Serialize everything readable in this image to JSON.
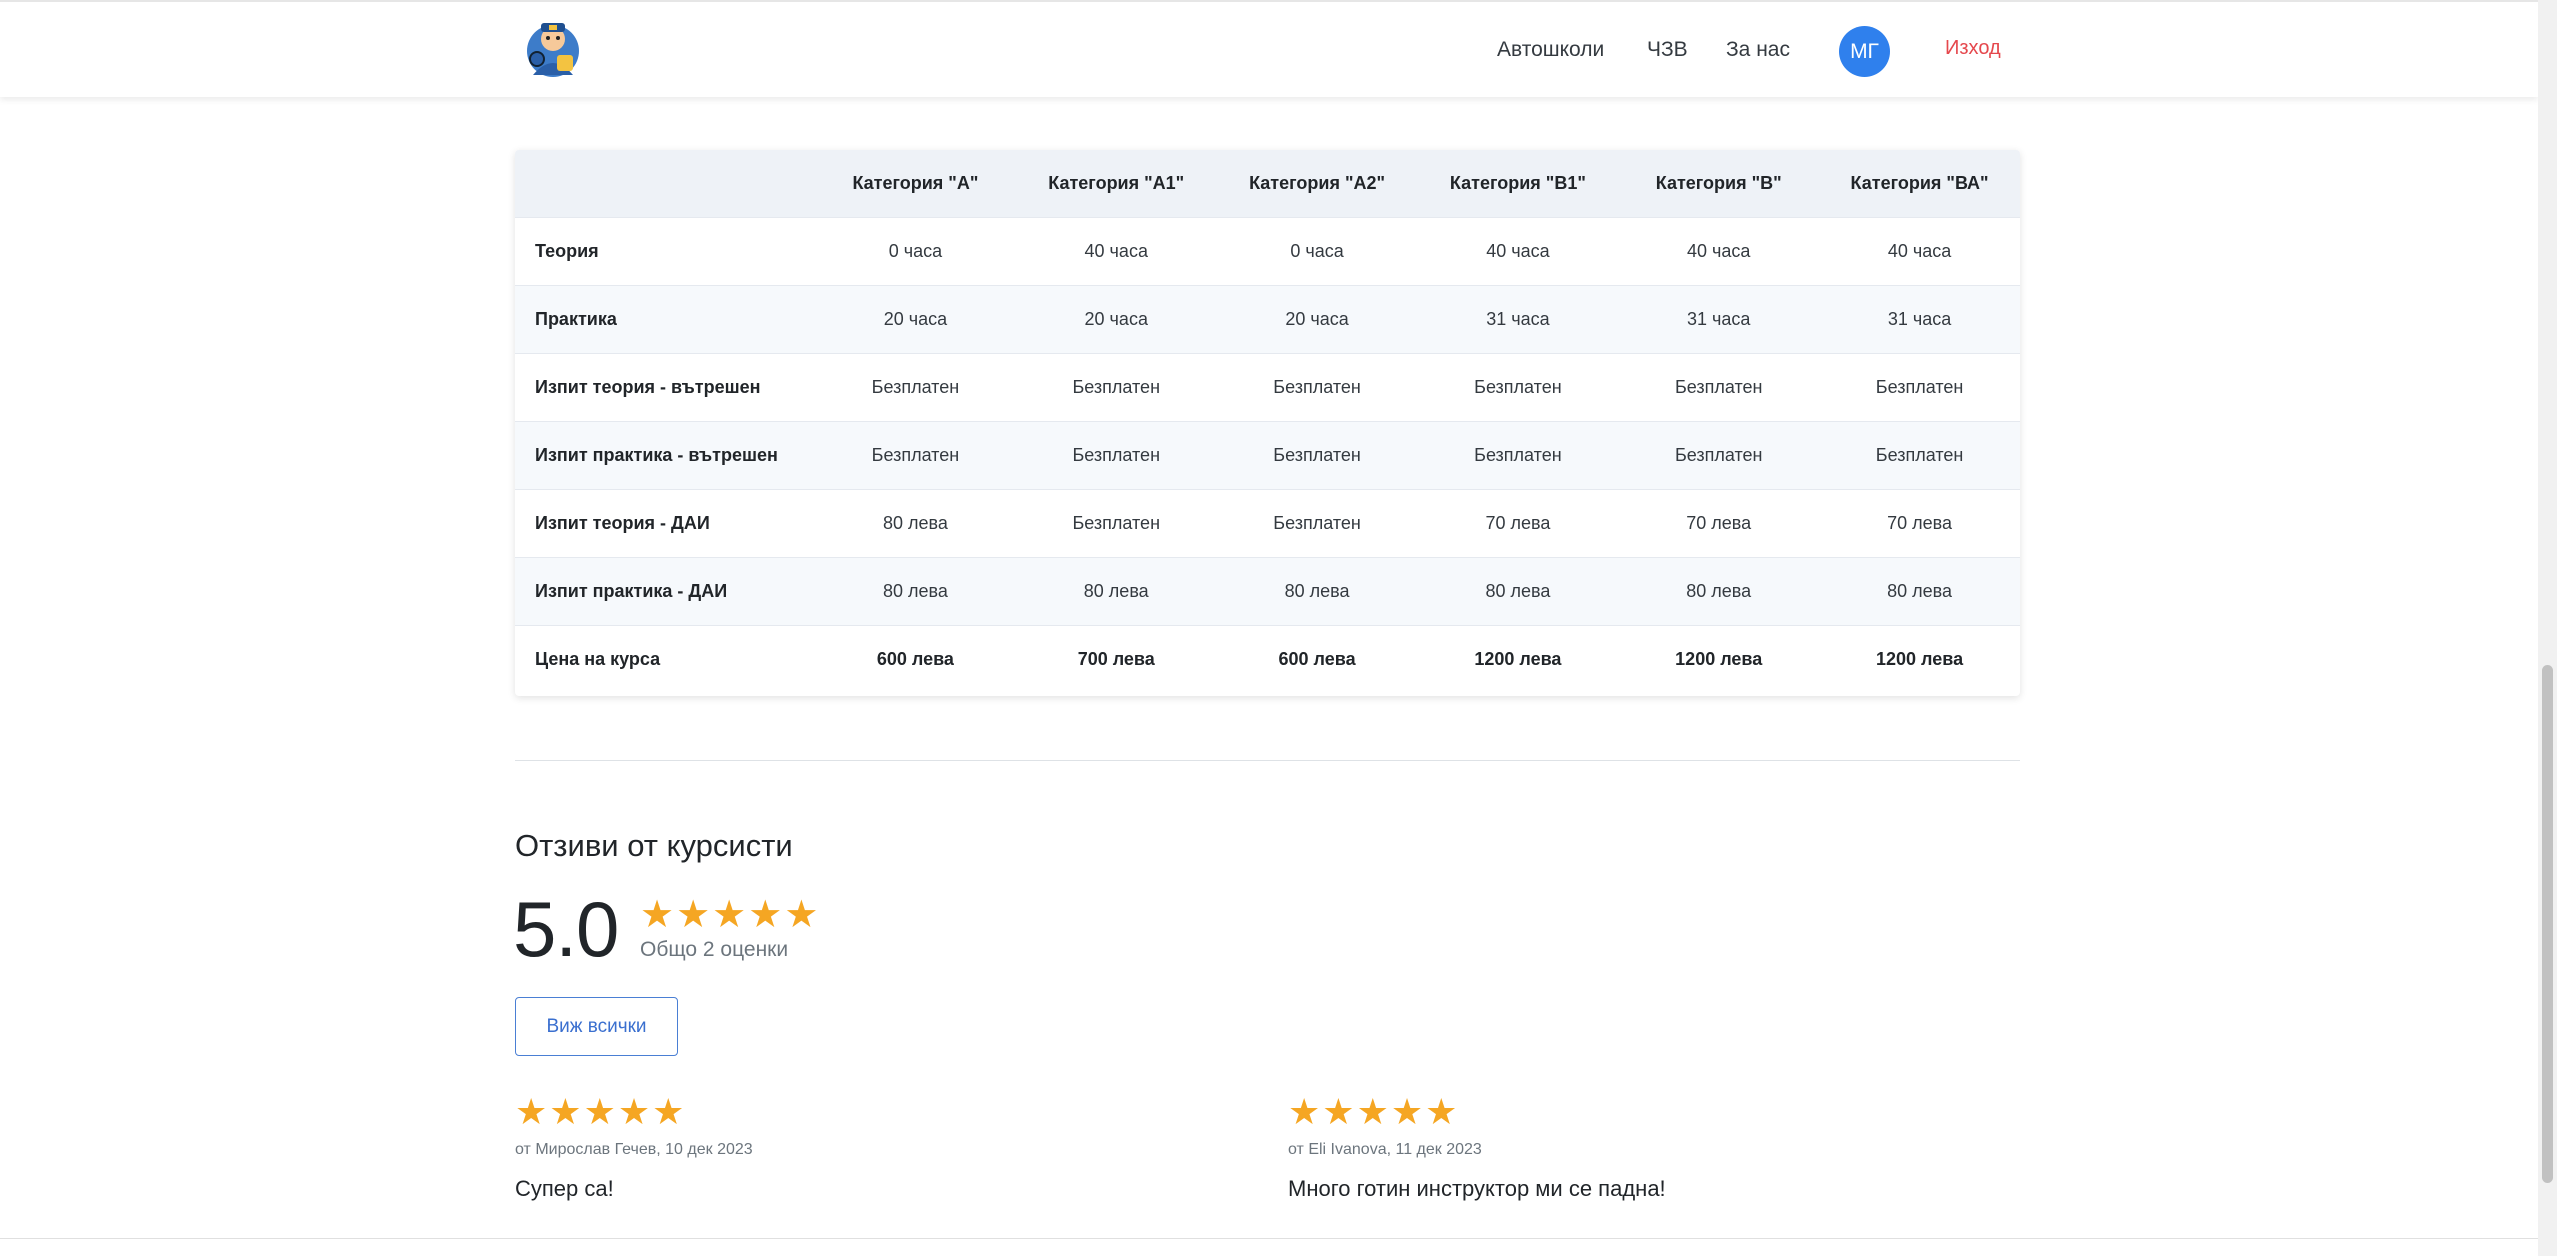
{
  "nav": {
    "links": [
      "Автошколи",
      "ЧЗВ",
      "За нас"
    ],
    "avatar_initials": "МГ",
    "logout": "Изход"
  },
  "table": {
    "headers": [
      "",
      "Категория \"А\"",
      "Категория \"А1\"",
      "Категория \"А2\"",
      "Категория \"В1\"",
      "Категория \"В\"",
      "Категория \"ВА\""
    ],
    "rows": [
      {
        "label": "Теория",
        "values": [
          "0 часа",
          "40 часа",
          "0 часа",
          "40 часа",
          "40 часа",
          "40 часа"
        ]
      },
      {
        "label": "Практика",
        "values": [
          "20 часа",
          "20 часа",
          "20 часа",
          "31 часа",
          "31 часа",
          "31 часа"
        ]
      },
      {
        "label": "Изпит теория - вътрешен",
        "values": [
          "Безплатен",
          "Безплатен",
          "Безплатен",
          "Безплатен",
          "Безплатен",
          "Безплатен"
        ]
      },
      {
        "label": "Изпит практика - вътрешен",
        "values": [
          "Безплатен",
          "Безплатен",
          "Безплатен",
          "Безплатен",
          "Безплатен",
          "Безплатен"
        ]
      },
      {
        "label": "Изпит теория - ДАИ",
        "values": [
          "80 лева",
          "Безплатен",
          "Безплатен",
          "70 лева",
          "70 лева",
          "70 лева"
        ]
      },
      {
        "label": "Изпит практика - ДАИ",
        "values": [
          "80 лева",
          "80 лева",
          "80 лева",
          "80 лева",
          "80 лева",
          "80 лева"
        ]
      },
      {
        "label": "Цена на курса",
        "values": [
          "600 лева",
          "700 лева",
          "600 лева",
          "1200 лева",
          "1200 лева",
          "1200 лева"
        ]
      }
    ]
  },
  "reviews": {
    "title": "Отзиви от курсисти",
    "average": "5.0",
    "average_stars": 5,
    "total": "Общо 2 оценки",
    "view_all": "Виж всички",
    "items": [
      {
        "stars": 5,
        "meta": "от Мирослав Гечев, 10 дек 2023",
        "text": "Супер са!"
      },
      {
        "stars": 5,
        "meta": "от Eli Ivanova, 11 дек 2023",
        "text": "Много готин инструктор ми се падна!"
      }
    ]
  },
  "colors": {
    "accent": "#2f80ed",
    "star": "#f5a623",
    "logout": "#e5484d"
  }
}
